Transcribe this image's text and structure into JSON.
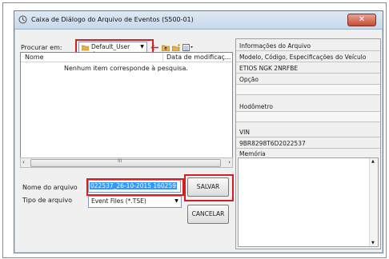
{
  "colors": {
    "highlight_box": "#d21f26",
    "selection": "#3399ff",
    "folder_yellow": "#e7b24a"
  },
  "window": {
    "title": "Caixa de Diálogo do Arquivo de Eventos (S500-01)",
    "close_glyph": "✕",
    "title_icon": "app-icon"
  },
  "toolbar": {
    "look_in_label": "Procurar em:",
    "look_in_value": "Default_User",
    "icons": [
      "back-arrow-icon",
      "up-folder-icon",
      "new-folder-icon",
      "view-menu-icon"
    ]
  },
  "file_list": {
    "columns": [
      "Nome",
      "Data de modificaç..."
    ],
    "empty_message": "Nenhum item corresponde à pesquisa.",
    "scroll_grip": "III"
  },
  "form": {
    "filename_label": "Nome do arquivo",
    "filename_value": "022537_26-10-2015 160259",
    "filetype_label": "Tipo de arquivo",
    "filetype_value": "Event Files (*.TSE)",
    "save_label": "SALVAR",
    "cancel_label": "CANCELAR"
  },
  "info_panel": {
    "header": "Informações do Arquivo",
    "model_label": "Modelo, Código, Especificações do Veículo",
    "model_value": "ETIOS NGK 2NRFBE",
    "option_label": "Opção",
    "odometer_label": "Hodômetro",
    "vin_label": "VIN",
    "vin_value": "9BR8298T6D2022537",
    "memory_label": "Memória"
  }
}
